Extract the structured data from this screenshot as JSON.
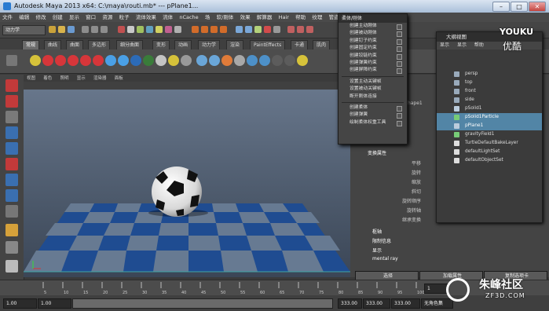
{
  "window": {
    "title": "Autodesk Maya 2013 x64: C:\\maya\\routi.mb* --- pPlane1...",
    "controls": [
      "–",
      "□",
      "✕"
    ]
  },
  "menubar": [
    "文件",
    "编辑",
    "修改",
    "创建",
    "显示",
    "窗口",
    "资源",
    "粒子",
    "流体效果",
    "流体",
    "nCache",
    "场",
    "软/刚体",
    "效果",
    "解算器",
    "Hair",
    "帮助",
    "纹理",
    "管道缓存"
  ],
  "status": {
    "mode": "动力学"
  },
  "shelf_tabs": [
    "常规",
    "曲线",
    "曲面",
    "多边形",
    "细分曲面",
    "变形",
    "动画",
    "动力学",
    "渲染",
    "PaintEffects",
    "卡通",
    "肌肉"
  ],
  "shelf_tab_active": 0,
  "viewport": {
    "menu": [
      "视图",
      "着色",
      "照明",
      "显示",
      "渲染器",
      "面板"
    ]
  },
  "dynamics_menu": {
    "title": "柔体/刚体",
    "items": [
      "创建主动刚体",
      "创建被动刚体",
      "创建钉子约束",
      "创建固定约束",
      "创建铰链约束",
      "创建弹簧约束",
      "创建屏障约束",
      "设置主动关键帧",
      "设置被动关键帧",
      "断开刚体连接",
      "创建柔体",
      "创建弹簧",
      "绘制柔体权重工具"
    ]
  },
  "outliner": {
    "title": "大纲视图",
    "menu": [
      "显示",
      "显示",
      "帮助"
    ],
    "rows": [
      {
        "label": "persp",
        "selected": false
      },
      {
        "label": "top",
        "selected": false
      },
      {
        "label": "front",
        "selected": false
      },
      {
        "label": "side",
        "selected": false
      },
      {
        "label": "pSolid1",
        "selected": false
      },
      {
        "label": "pSolid1Particle",
        "selected": true
      },
      {
        "label": "pPlane1",
        "selected": true
      },
      {
        "label": "gravityField1",
        "selected": false
      },
      {
        "label": "TurtleDefaultBakeLayer",
        "selected": false
      },
      {
        "label": "defaultLightSet",
        "selected": false
      },
      {
        "label": "defaultObjectSet",
        "selected": false
      }
    ]
  },
  "attr": {
    "shape": "lidShape1",
    "transform_label": "变换属性",
    "fields": [
      "平移",
      "旋转",
      "缩放",
      "斜切",
      "旋转顺序",
      "旋转轴",
      "继承变换"
    ],
    "sections": [
      "枢轴",
      "限制信息",
      "显示",
      "mental ray"
    ],
    "buttons": [
      "选择",
      "加载属性",
      "复制选项卡"
    ]
  },
  "timeline": {
    "start": "1.00",
    "start2": "1.00",
    "current": "1",
    "end1": "333.00",
    "end2": "333.00",
    "end3": "333.00",
    "char": "无角色集",
    "ticks": [
      "5",
      "10",
      "15",
      "20",
      "25",
      "30",
      "35",
      "40",
      "45",
      "50",
      "55",
      "60",
      "65",
      "70",
      "75",
      "80",
      "85",
      "90",
      "95",
      "100"
    ]
  },
  "watermarks": {
    "youku": "YOUKU",
    "youku_cn": "优酷",
    "site": "朱峰社区",
    "site_url": "ZF3D.COM"
  }
}
